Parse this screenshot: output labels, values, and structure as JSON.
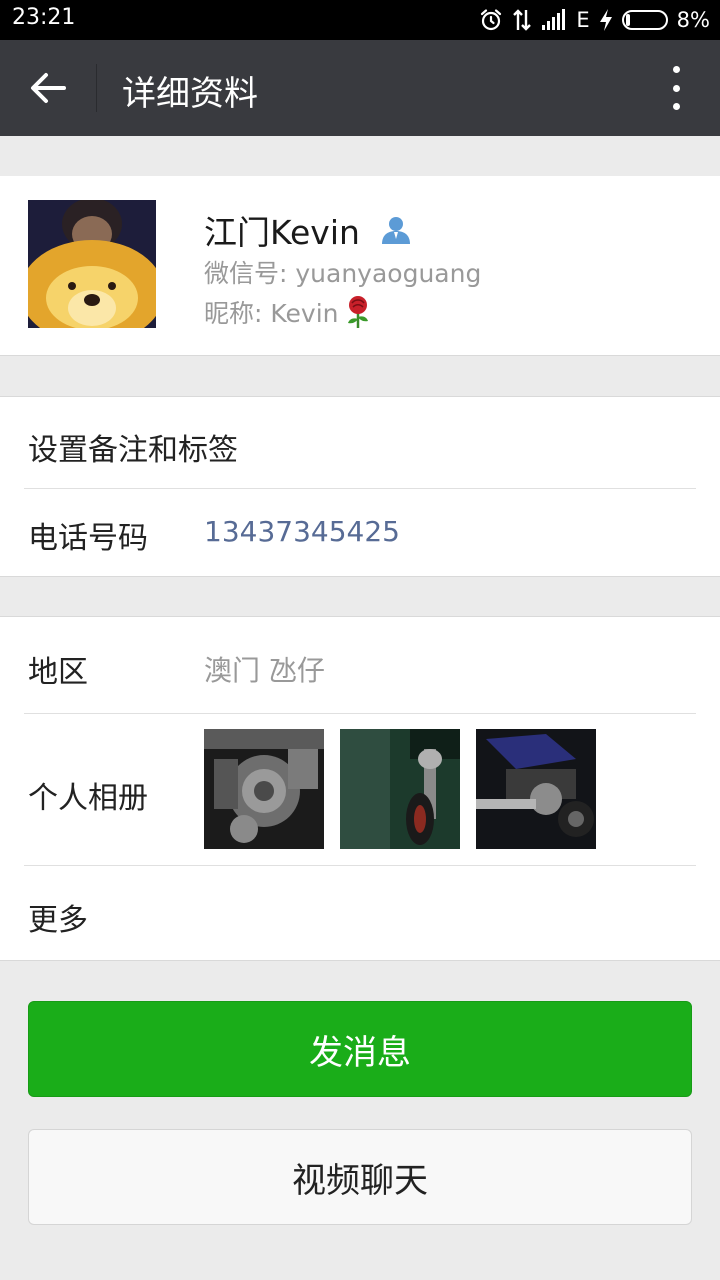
{
  "status_bar": {
    "time": "23:21",
    "network": "E",
    "battery_text": "8%",
    "battery_level": 0.08,
    "icons": [
      "alarm-icon",
      "data-transfer-icon",
      "signal-icon",
      "charging-icon",
      "battery-icon"
    ]
  },
  "app_bar": {
    "title": "详细资料",
    "back_icon": "back-arrow-icon",
    "more_icon": "more-vertical-icon"
  },
  "profile": {
    "name": "江门Kevin",
    "wechat_id": "微信号: yuanyaoguang",
    "nickname": "昵称: Kevin",
    "star_friend_icon": "person-icon",
    "nickname_emoji_icon": "rose-icon"
  },
  "contact": {
    "remark_label": "设置备注和标签",
    "phone_label": "电话号码",
    "phone_value": "13437345425"
  },
  "info": {
    "region_label": "地区",
    "region_value": "澳门  氹仔",
    "album_label": "个人相册",
    "more_label": "更多",
    "album_photos": [
      "motorcycle-engine-photo",
      "motorcycle-front-photo",
      "motorcycle-side-photo"
    ]
  },
  "actions": {
    "send_message": "发消息",
    "video_chat": "视频聊天"
  },
  "colors": {
    "app_bar_bg": "#393a3f",
    "primary_green": "#1aad19",
    "phone_link": "#576b95",
    "secondary_text": "#999999",
    "page_bg": "#ebebeb"
  }
}
